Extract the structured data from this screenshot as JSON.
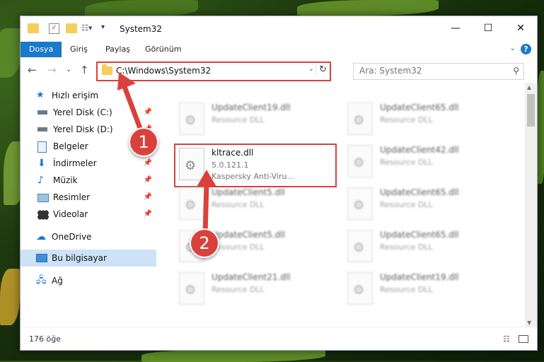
{
  "window": {
    "title": "System32",
    "controls": {
      "minimize": "—",
      "maximize": "☐",
      "close": "✕"
    }
  },
  "ribbon": {
    "tabs": [
      "Dosya",
      "Giriş",
      "Paylaş",
      "Görünüm"
    ],
    "help": "?"
  },
  "address": {
    "path": "C:\\Windows\\System32",
    "search_placeholder": "Ara: System32"
  },
  "nav": {
    "items": [
      {
        "label": "Hızlı erişim",
        "icon": "star-icon",
        "pinned": false
      },
      {
        "label": "Yerel Disk (C:)",
        "icon": "drive-icon",
        "pinned": true
      },
      {
        "label": "Yerel Disk (D:)",
        "icon": "drive-icon",
        "pinned": true
      },
      {
        "label": "Belgeler",
        "icon": "document-icon",
        "pinned": true
      },
      {
        "label": "İndirmeler",
        "icon": "download-icon",
        "pinned": true
      },
      {
        "label": "Müzik",
        "icon": "music-icon",
        "pinned": true
      },
      {
        "label": "Resimler",
        "icon": "pictures-icon",
        "pinned": true
      },
      {
        "label": "Videolar",
        "icon": "video-icon",
        "pinned": true
      },
      {
        "label": "OneDrive",
        "icon": "cloud-icon",
        "pinned": false
      },
      {
        "label": "Bu bilgisayar",
        "icon": "computer-icon",
        "pinned": false
      },
      {
        "label": "Ağ",
        "icon": "network-icon",
        "pinned": false
      }
    ]
  },
  "files": {
    "highlighted": {
      "name": "kltrace.dll",
      "version": "5.0.121.1",
      "company": "Kaspersky Anti-Viru..."
    },
    "background": [
      {
        "name": "UpdateClient19.dll",
        "desc": "Resource DLL"
      },
      {
        "name": "UpdateClient65.dll",
        "desc": "Resource DLL"
      },
      {
        "name": "UpdateClient42.dll",
        "desc": "Resource DLL"
      },
      {
        "name": "UpdateClient5.dll",
        "desc": "Resource DLL"
      },
      {
        "name": "UpdateClient65.dll",
        "desc": "Resource DLL"
      },
      {
        "name": "UpdateClient5.dll",
        "desc": "Resource DLL"
      },
      {
        "name": "UpdateClient65.dll",
        "desc": "Resource DLL"
      },
      {
        "name": "UpdateClient21.dll",
        "desc": "Resource DLL"
      },
      {
        "name": "UpdateClient19.dll",
        "desc": "Resource DLL"
      }
    ]
  },
  "status": {
    "count": "176 öğe"
  },
  "annotations": {
    "one": "1",
    "two": "2"
  },
  "colors": {
    "accent": "#1979ca",
    "highlight": "#d9423c",
    "selected": "#cde2f7"
  }
}
